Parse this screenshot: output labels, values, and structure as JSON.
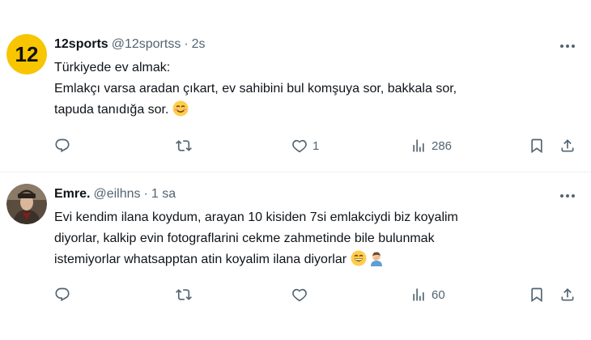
{
  "tweets": [
    {
      "name": "12sports",
      "handle": "@12sportss",
      "time": "2s",
      "avatar_text": "12",
      "lines": [
        "Türkiyede ev almak:",
        "Emlakçı varsa aradan çıkart, ev sahibini bul komşuya sor, bakkala sor,",
        "tapuda tanıdığa sor."
      ],
      "emojis": [
        "smiling-face-emoji"
      ],
      "likes": "1",
      "views": "286"
    },
    {
      "name": "Emre.",
      "handle": "@eilhns",
      "time": "1 sa",
      "lines": [
        "Evi kendim ilana koydum, arayan 10 kisiden 7si emlakciydi biz koyalim",
        "diyorlar, kalkip evin fotograflarini cekme zahmetinde bile bulunmak",
        "istemiyorlar whatsapptan atin koyalim ilana diyorlar"
      ],
      "emojis": [
        "grinning-face-emoji",
        "man-facepalming-emoji"
      ],
      "views": "60"
    }
  ],
  "colors": {
    "text": "#0f1419",
    "secondary": "#536471",
    "divider": "#eff3f4",
    "avatar_yellow": "#f7c600"
  }
}
